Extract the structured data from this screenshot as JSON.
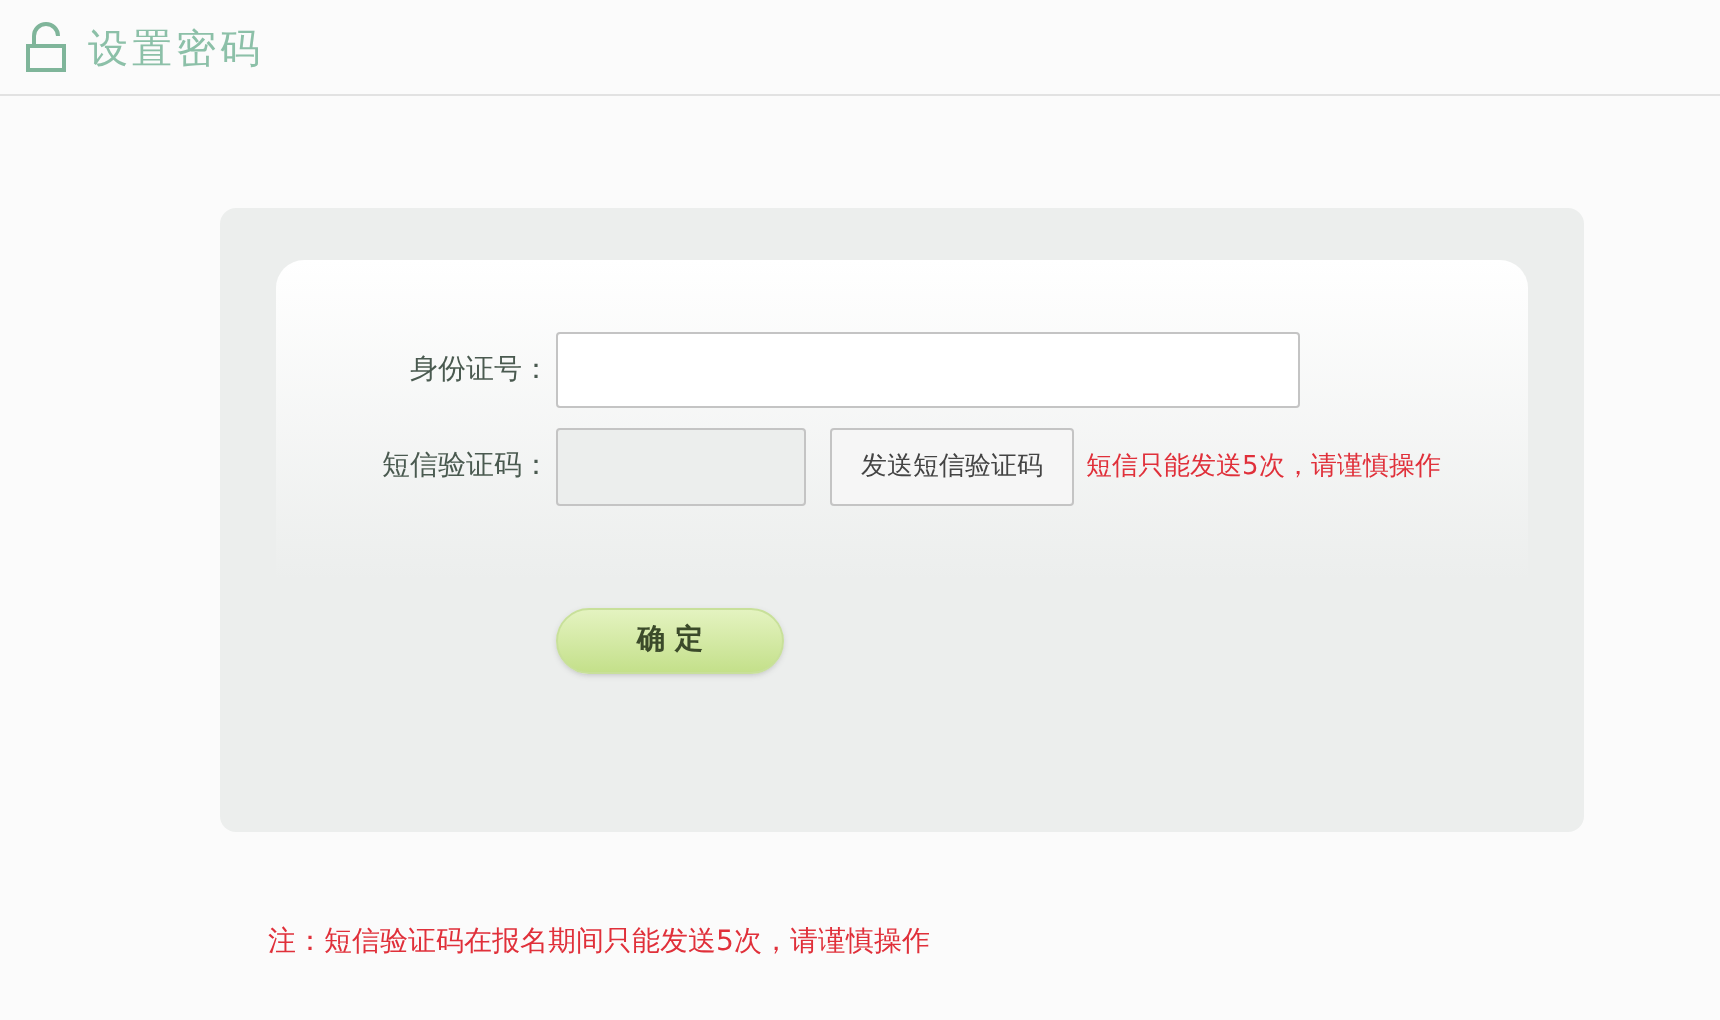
{
  "header": {
    "title": "设置密码"
  },
  "form": {
    "fields": [
      {
        "kind": "id",
        "label": "身份证号："
      },
      {
        "kind": "code",
        "label": "短信验证码：",
        "button": "发送短信验证码",
        "hint": "短信只能发送5次，请谨慎操作"
      }
    ],
    "submit": "确 定"
  },
  "note": "注：短信验证码在报名期间只能发送5次，请谨慎操作"
}
